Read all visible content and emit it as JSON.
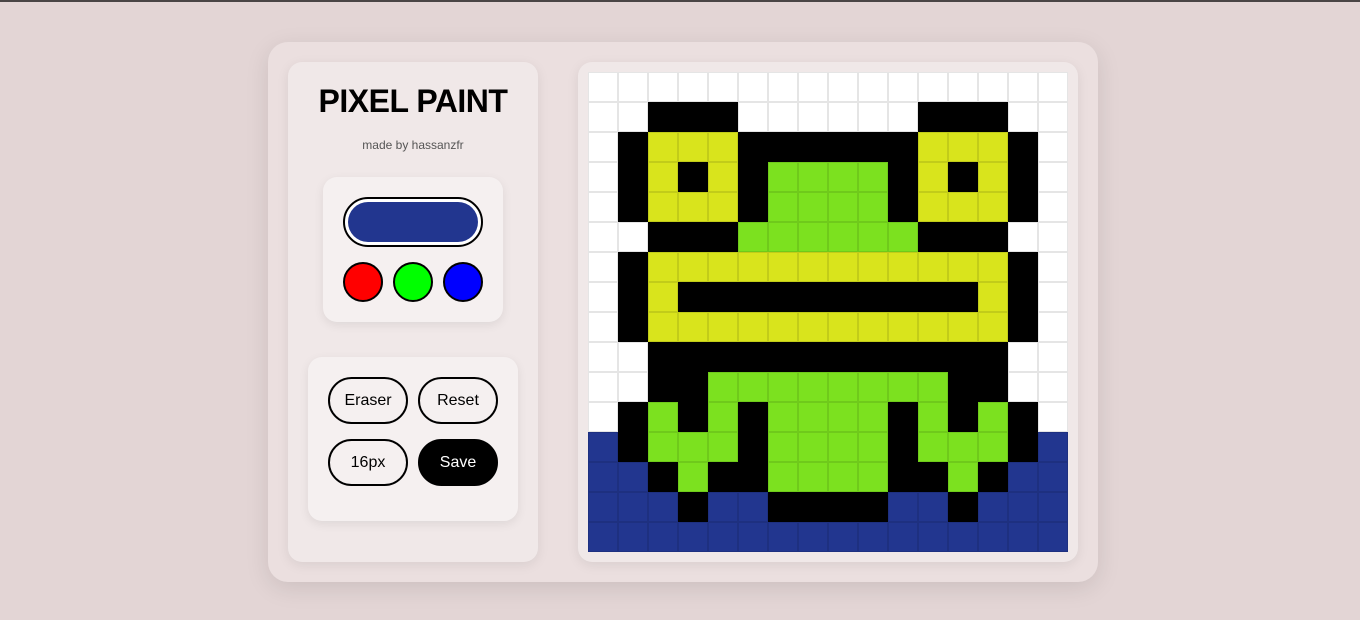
{
  "app": {
    "title": "PIXEL PAINT",
    "subtitle": "made by hassanzfr"
  },
  "colors": {
    "current": "#22368f",
    "swatches": [
      {
        "name": "red",
        "color": "#ff0000"
      },
      {
        "name": "green",
        "color": "#00ff00"
      },
      {
        "name": "blue",
        "color": "#0000ff"
      }
    ]
  },
  "tools": {
    "eraser_label": "Eraser",
    "reset_label": "Reset",
    "size_label": "16px",
    "save_label": "Save"
  },
  "canvas": {
    "palette": {
      "W": "#ffffff",
      "K": "#000000",
      "Y": "#d9e41c",
      "G": "#7ce11f",
      "B": "#22368f"
    },
    "rows": [
      "WWWWWWWWWWWWWWWW",
      "WWKKKWWWWWWKKKWW",
      "WKYYYKKKKKKYYYKW",
      "WKYKYKGGGGKYKYKW",
      "WKYYYKGGGGKYYYKW",
      "WWKKKGGGGGGKKKWW",
      "WKYYYYYYYYYYYYKW",
      "WKYKKKKKKKKKKYKW",
      "WKYYYYYYYYYYYYKW",
      "WWKKKKKKKKKKKKWW",
      "WWKKGGGGGGGGKKWW",
      "WKGKGKGGGGKGKGKW",
      "BKGGGKGGGGKGGGKB",
      "BBKGKKGGGGKKGKBB",
      "BBBKBBKKKKBBKBBB",
      "BBBBBBBBBBBBBBBB"
    ]
  }
}
